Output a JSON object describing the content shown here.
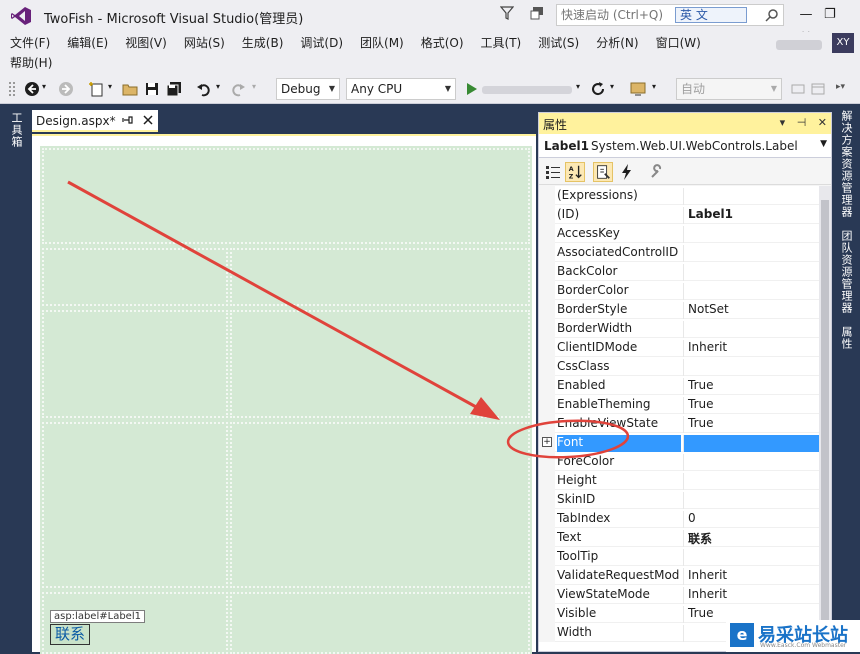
{
  "window": {
    "title": "TwoFish - Microsoft Visual Studio(管理员)",
    "quick_launch_placeholder": "快速启动 (Ctrl+Q)",
    "ime_indicator": "英 文",
    "user_initials": "XY",
    "controls": [
      "—",
      "❐",
      "✕"
    ]
  },
  "menu": {
    "items": [
      "文件(F)",
      "编辑(E)",
      "视图(V)",
      "网站(S)",
      "生成(B)",
      "调试(D)",
      "团队(M)",
      "格式(O)",
      "工具(T)",
      "测试(S)",
      "分析(N)",
      "窗口(W)"
    ],
    "help": "帮助(H)"
  },
  "toolbar": {
    "configuration": "Debug",
    "platform": "Any CPU",
    "auto_select": "自动"
  },
  "left_strip": {
    "label": "工具箱"
  },
  "document": {
    "tab_label": "Design.aspx*",
    "control_tag": "asp:label#Label1",
    "control_text": "联系"
  },
  "properties": {
    "panel_title": "属性",
    "object_name": "Label1",
    "object_type": "System.Web.UI.WebControls.Label",
    "rows": [
      {
        "name": "(Expressions)",
        "value": ""
      },
      {
        "name": "(ID)",
        "value": "Label1"
      },
      {
        "name": "AccessKey",
        "value": ""
      },
      {
        "name": "AssociatedControlID",
        "value": ""
      },
      {
        "name": "BackColor",
        "value": ""
      },
      {
        "name": "BorderColor",
        "value": ""
      },
      {
        "name": "BorderStyle",
        "value": "NotSet"
      },
      {
        "name": "BorderWidth",
        "value": ""
      },
      {
        "name": "ClientIDMode",
        "value": "Inherit"
      },
      {
        "name": "CssClass",
        "value": ""
      },
      {
        "name": "Enabled",
        "value": "True"
      },
      {
        "name": "EnableTheming",
        "value": "True"
      },
      {
        "name": "EnableViewState",
        "value": "True"
      },
      {
        "name": "Font",
        "value": ""
      },
      {
        "name": "ForeColor",
        "value": ""
      },
      {
        "name": "Height",
        "value": ""
      },
      {
        "name": "SkinID",
        "value": ""
      },
      {
        "name": "TabIndex",
        "value": "0"
      },
      {
        "name": "Text",
        "value": "联系"
      },
      {
        "name": "ToolTip",
        "value": ""
      },
      {
        "name": "ValidateRequestMod",
        "value": "Inherit"
      },
      {
        "name": "ViewStateMode",
        "value": "Inherit"
      },
      {
        "name": "Visible",
        "value": "True"
      },
      {
        "name": "Width",
        "value": ""
      }
    ],
    "selected_row": "Font",
    "highlight_color": "#3399FF"
  },
  "right_strip": {
    "labels": [
      "解决方案资源管理器",
      "团队资源管理器",
      "属性"
    ]
  },
  "watermark": {
    "logo_glyph": "e",
    "text": "易采站长站",
    "subtext": "Www.Easck.Com Webmaster"
  },
  "colors": {
    "title_bar": "#EEEEF2",
    "active_tab_accent": "#FFF29D",
    "design_surface": "#D4E9D4",
    "annotation_red": "#E0433B"
  }
}
